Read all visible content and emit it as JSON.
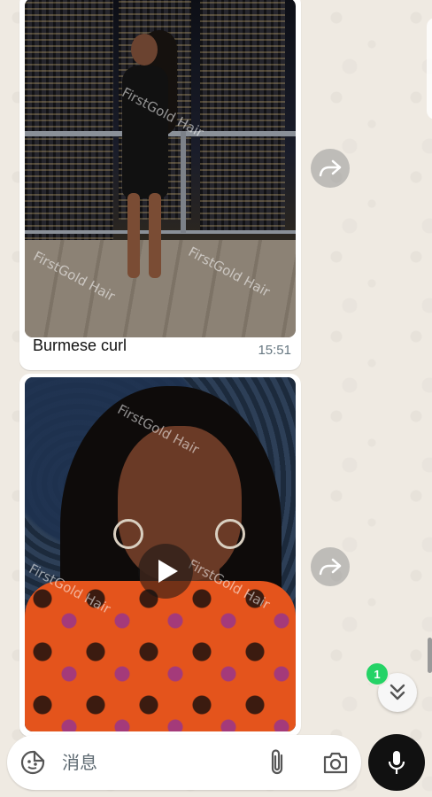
{
  "messages": [
    {
      "type": "image",
      "caption": "Burmese curl",
      "time": "15:51",
      "watermark": "FirstGold Hair"
    },
    {
      "type": "video",
      "watermark": "FirstGold Hair"
    }
  ],
  "scroll_down": {
    "unread_count": "1"
  },
  "composer": {
    "placeholder": "消息"
  },
  "colors": {
    "background": "#efeae2",
    "bubble": "#ffffff",
    "badge": "#25d366",
    "mic": "#111111",
    "timestamp": "#667781"
  },
  "icons": {
    "forward": "forward-icon",
    "play": "play-icon",
    "scroll_down": "double-chevron-down-icon",
    "emoji": "sticker-icon",
    "attach": "paperclip-icon",
    "camera": "camera-icon",
    "mic": "microphone-icon"
  }
}
